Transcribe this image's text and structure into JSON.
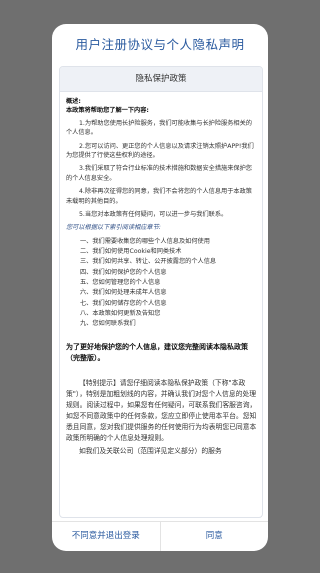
{
  "dialog": {
    "title": "用户注册协议与个人隐私声明"
  },
  "policy": {
    "header": "隐私保护政策",
    "overview_label": "概述:",
    "intro": "本政策将帮助您了解一下内容:",
    "items": [
      "1.为帮助您使用长护险服务，我们可能收集与长护险服务相关的个人信息。",
      "2.您可以访问、更正您的个人信息以及请求注销太照护APP!我们为您提供了行使这些权利的途径。",
      "3.我们采取了符合行业标准的技术措施和数据安全措施来保护您的个人信息安全。",
      "4.除非再次征得您的同意，我们不会将您的个人信息用于本政策未载明的其他目的。",
      "5.当您对本政策有任何疑问，可以进一步与我们联系。"
    ],
    "toc_intro": "您可以根据以下索引阅读相应章节:",
    "toc": [
      "一、我们需要收集您的哪些个人信息及如何使用",
      "二、我们如何使用Cookie和同类技术",
      "三、我们如何共享、转让、公开披露您的个人信息",
      "四、我们如何保护您的个人信息",
      "五、您如何管理您的个人信息",
      "六、我们如何处理未成年人信息",
      "七、我们如何储存您的个人信息",
      "八、本政策如何更新及告知您",
      "九、您如何联系我们"
    ],
    "emphasis": "为了更好地保护您的个人信息，建议您完整阅读本隐私政策（完整版）。",
    "special_notice": "【特别提示】请您仔细阅读本隐私保护政策（下称\"本政策\"），特别是加粗划线的内容，并确认我们对您个人信息的处理规则。阅读过程中，如果您有任何疑问，可联系我们客服咨询，如您不同意政策中的任何条款，您应立即停止使用本平台。您知悉且同意，您对我们提供服务的任何使用行为均表明您已同意本政策所明确的个人信息处理规则。",
    "trailing": "如我们及关联公司（范围详见定义部分）的服务"
  },
  "buttons": {
    "decline": "不同意并退出登录",
    "agree": "同意"
  }
}
